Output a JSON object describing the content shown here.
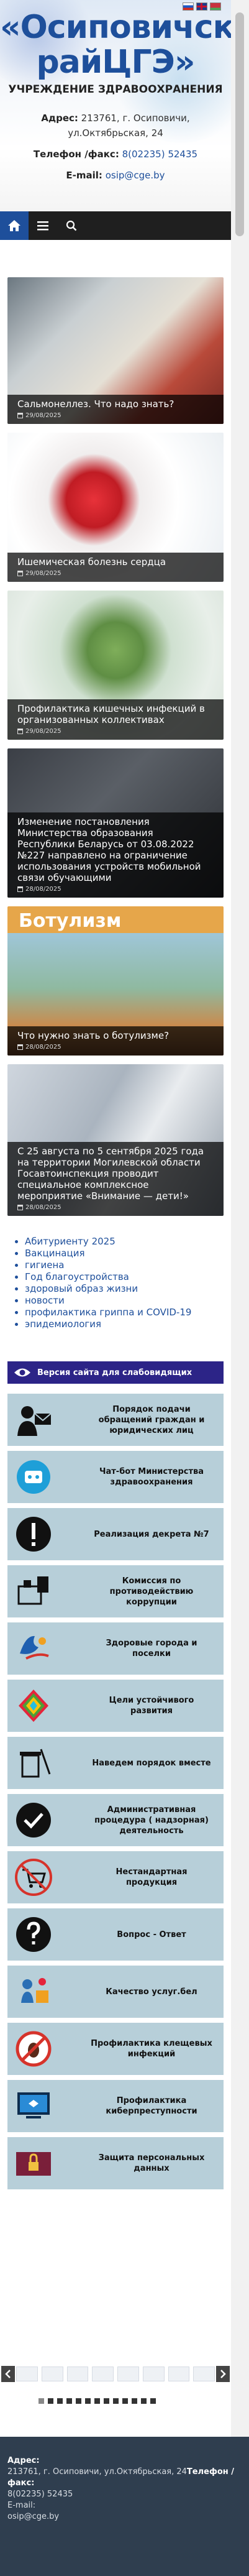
{
  "header": {
    "languages": [
      "ru",
      "en",
      "by"
    ],
    "title": "«Осиповичский райЦГЭ»",
    "subtitle": "УЧРЕЖДЕНИЕ ЗДРАВООХРАНЕНИЯ",
    "address_label": "Адрес:",
    "address_value": "213761, г. Осиповичи, ул.Октябрьская, 24",
    "phone_label": "Телефон /факс:",
    "phone_value": "8(02235) 52435",
    "email_label": "E-mail:",
    "email_value": "osip@cge.by"
  },
  "nav": {
    "icons": [
      "home-icon",
      "menu-icon",
      "search-icon"
    ]
  },
  "news": [
    {
      "title": "Сальмонеллез. Что надо знать?",
      "date": "29/08/2025"
    },
    {
      "title": "Ишемическая болезнь сердца",
      "date": "29/08/2025"
    },
    {
      "title": "Профилактика кишечных инфекций в организованных коллективах",
      "date": "29/08/2025"
    },
    {
      "title": "Изменение постановления Министерства образования Республики Беларусь от 03.08.2022 №227 направлено на ограничение использования устройств мобильной связи обучающими",
      "date": "28/08/2025"
    },
    {
      "title": "Что нужно знать о ботулизме?",
      "date": "28/08/2025",
      "image_text": "Ботулизм"
    },
    {
      "title": "С 25 августа по 5 сентября 2025 года на территории Могилевской области Госавтоинспекция проводит специальное комплексное мероприятие «Внимание — дети!»",
      "date": "28/08/2025"
    }
  ],
  "links": [
    "Абитуриенту 2025",
    "Вакцинация",
    "гигиена",
    "Год благоустройства",
    "здоровый образ жизни",
    "новости",
    "профилактика гриппа и COVID-19",
    "эпидемиология"
  ],
  "accessibility": {
    "label": "Версия сайта для слабовидящих"
  },
  "banners": [
    {
      "label": "Порядок подачи обращений граждан и юридических лиц",
      "icon": "mail-person-icon"
    },
    {
      "label": "Чат-бот Министерства здравоохранения",
      "icon": "chatbot-icon"
    },
    {
      "label": "Реализация декрета №7",
      "icon": "exclamation-icon"
    },
    {
      "label": "Комиссия по противодействию коррупции",
      "icon": "anticorruption-icon"
    },
    {
      "label": "Здоровые города и поселки",
      "icon": "healthy-city-icon"
    },
    {
      "label": "Цели устойчивого развития",
      "icon": "sdg-icon"
    },
    {
      "label": "Наведем порядок вместе",
      "icon": "clean-up-icon"
    },
    {
      "label": "Административная процедура ( надзорная) деятельность",
      "icon": "check-badge-icon"
    },
    {
      "label": "Нестандартная продукция",
      "icon": "cart-icon"
    },
    {
      "label": "Вопрос - Ответ",
      "icon": "question-icon"
    },
    {
      "label": "Качество услуг.бел",
      "icon": "quality-icon"
    },
    {
      "label": "Профилактика клещевых инфекций",
      "icon": "tick-icon"
    },
    {
      "label": "Профилактика киберпреступности",
      "icon": "cyber-icon"
    },
    {
      "label": "Защита персональных данных",
      "icon": "lock-icon"
    }
  ],
  "carousel": {
    "prev_icon": "chevron-left-icon",
    "next_icon": "chevron-right-icon",
    "dot_count": 13
  },
  "footer": {
    "address_label": "Адрес:",
    "address_value": "213761, г. Осиповичи, ул.Октябрьская, 24",
    "phone_label": "Телефон /факс:",
    "phone_value": "8(02235) 52435",
    "email_label": "E-mail:",
    "email_value": "osip@cge.by"
  },
  "colors": {
    "brand_blue": "#1e4f9b",
    "nav_dark": "#1f1f1f",
    "accessibility_bar": "#2c2487",
    "banner_bg": "#b7cfd9",
    "footer_bg": "#2f3e4f"
  }
}
